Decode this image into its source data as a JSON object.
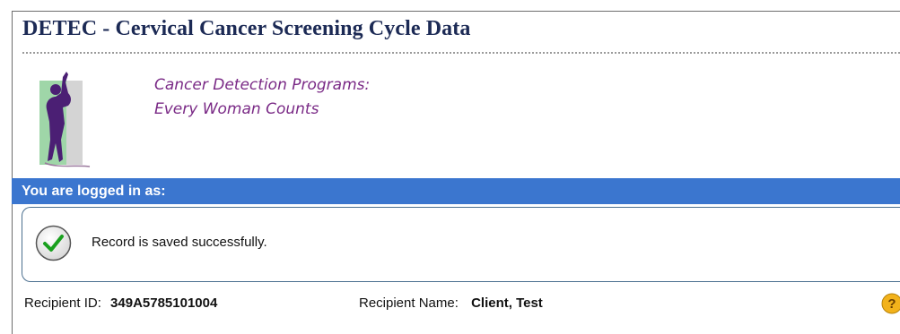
{
  "page": {
    "title": "DETEC - Cervical Cancer Screening Cycle Data"
  },
  "program": {
    "line1": "Cancer Detection Programs:",
    "line2": "Every Woman Counts"
  },
  "login_bar": {
    "label": "You are logged in as:"
  },
  "message": {
    "text": "Record is saved successfully.",
    "icon": "checkmark-icon"
  },
  "recipient": {
    "id_label": "Recipient ID:",
    "id_value": "349A5785101004",
    "name_label": "Recipient Name:",
    "name_value": "Client, Test"
  },
  "help": {
    "icon": "help-icon"
  },
  "colors": {
    "title": "#1c2a55",
    "program_text": "#7a2a86",
    "login_bar": "#3b76cf",
    "success_check": "#19a01e"
  }
}
